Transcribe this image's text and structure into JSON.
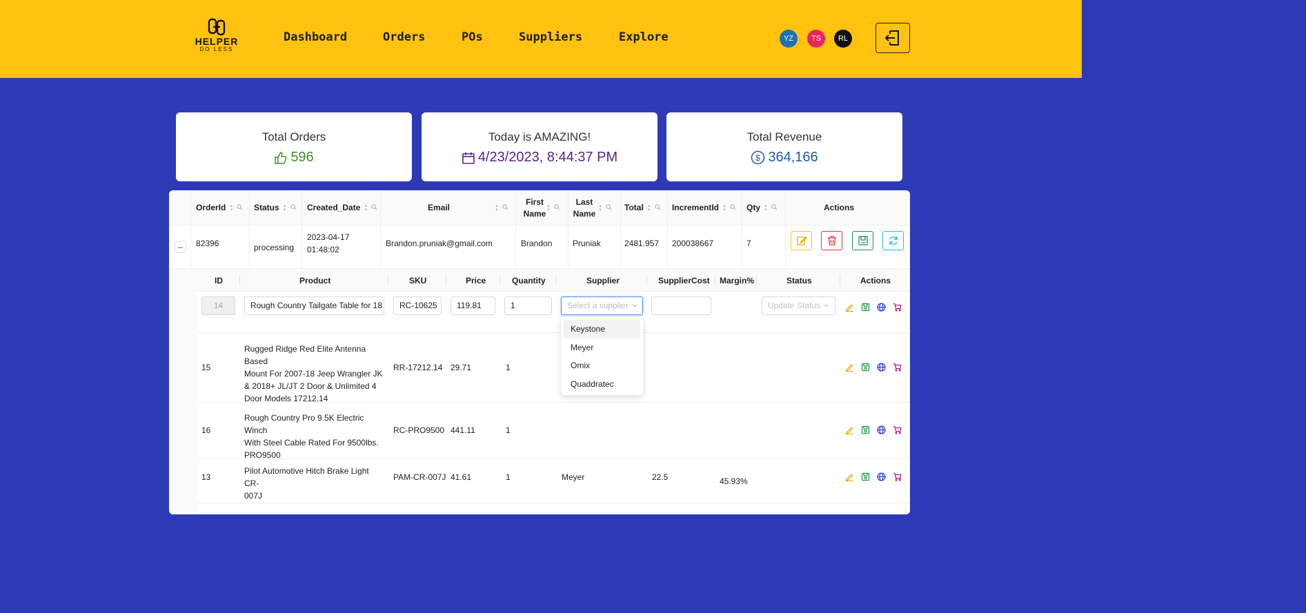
{
  "brand": {
    "line1": "HELPER",
    "line2": "DO LESS"
  },
  "nav": [
    "Dashboard",
    "Orders",
    "POs",
    "Suppliers",
    "Explore"
  ],
  "avatars": [
    {
      "initials": "YZ",
      "color": "#1f6fb5"
    },
    {
      "initials": "TS",
      "color": "#e8245d"
    },
    {
      "initials": "RL",
      "color": "#111111"
    }
  ],
  "stats": {
    "orders": {
      "title": "Total Orders",
      "value": "596",
      "color": "#3f8f2a"
    },
    "today": {
      "title": "Today is AMAZING!",
      "value": "4/23/2023, 8:44:37 PM",
      "color": "#5a1f8a"
    },
    "revenue": {
      "title": "Total Revenue",
      "value": "364,166",
      "color": "#1f5aa0"
    }
  },
  "orders_table": {
    "columns": [
      "OrderId",
      "Status",
      "Created_Date",
      "Email",
      "First Name",
      "Last Name",
      "Total",
      "IncrementId",
      "Qty",
      "Actions"
    ],
    "row": {
      "order_id": "82396",
      "status": "processing",
      "created_date": "2023-04-17 01:48:02",
      "created_date_l1": "2023-04-17",
      "created_date_l2": "01:48:02",
      "email": "Brandon.pruniak@gmail.com",
      "first_name": "Brandon",
      "last_name": "Pruniak",
      "total": "2481.957",
      "increment_id": "200038667",
      "qty": "7"
    },
    "expand_symbol": "–"
  },
  "items_table": {
    "columns": [
      "ID",
      "Product",
      "SKU",
      "Price",
      "Quantity",
      "Supplier",
      "SupplierCost",
      "Margin%",
      "Status",
      "Actions"
    ],
    "edit_row": {
      "id": "14",
      "product": "Rough Country Tailgate Table for 18",
      "sku": "RC-10625",
      "price": "119.81",
      "quantity": "1",
      "supplier_placeholder": "Select a supplier",
      "supplier_cost": "",
      "status_placeholder": "Update Status"
    },
    "rows": [
      {
        "id": "15",
        "product": [
          "Rugged Ridge Red Elite Antenna Based",
          "Mount For 2007-18 Jeep Wrangler JK",
          "& 2018+ JL/JT 2 Door & Unlimited 4",
          "Door Models 17212.14"
        ],
        "sku": "RR-17212.14",
        "price": "29.71",
        "quantity": "1",
        "supplier": "",
        "supplier_cost": "",
        "margin": ""
      },
      {
        "id": "16",
        "product": [
          "Rough Country Pro 9.5K Electric Winch",
          "With Steel Cable Rated For 9500lbs.",
          "PRO9500"
        ],
        "sku": "RC-PRO9500",
        "price": "441.11",
        "quantity": "1",
        "supplier": "",
        "supplier_cost": "",
        "margin": ""
      },
      {
        "id": "13",
        "product": [
          "Pilot Automotive Hitch Brake Light CR-",
          "007J"
        ],
        "sku": "PAM-CR-007J",
        "price": "41.61",
        "quantity": "1",
        "supplier": "Meyer",
        "supplier_cost": "22.5",
        "margin": "45.93%"
      }
    ],
    "supplier_options": [
      "Keystone",
      "Meyer",
      "Omix",
      "Quaddratec"
    ]
  }
}
